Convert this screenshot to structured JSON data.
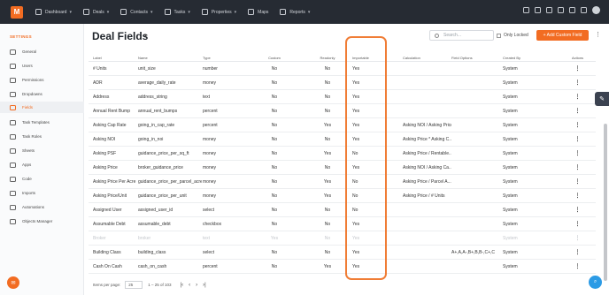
{
  "nav": {
    "logo_text": "M",
    "items": [
      {
        "label": "Dashboard",
        "icon": "home-icon"
      },
      {
        "label": "Deals",
        "icon": "deals-icon"
      },
      {
        "label": "Contacts",
        "icon": "contacts-icon"
      },
      {
        "label": "Tasks",
        "icon": "tasks-icon"
      },
      {
        "label": "Properties",
        "icon": "properties-icon"
      },
      {
        "label": "Maps",
        "icon": "maps-icon"
      },
      {
        "label": "Reports",
        "icon": "reports-icon"
      }
    ]
  },
  "sidebar": {
    "title": "SETTINGS",
    "items": [
      {
        "label": "General"
      },
      {
        "label": "Users"
      },
      {
        "label": "Permissions"
      },
      {
        "label": "Dropdowns"
      },
      {
        "label": "Fields"
      },
      {
        "label": "Task Templates"
      },
      {
        "label": "Task Roles"
      },
      {
        "label": "Sheets"
      },
      {
        "label": "Apps"
      },
      {
        "label": "Code"
      },
      {
        "label": "Imports"
      },
      {
        "label": "Automations"
      },
      {
        "label": "Objects Manager"
      }
    ]
  },
  "header": {
    "title": "Deal Fields",
    "search_placeholder": "Search...",
    "only_locked_label": "Only Locked",
    "add_button_label": "+ Add Custom Field"
  },
  "table": {
    "columns": [
      "Label",
      "Name",
      "Type",
      "Custom",
      "Readonly",
      "Importable",
      "Calculation",
      "Field Options",
      "Created By",
      "Actions"
    ],
    "rows": [
      {
        "label": "# Units",
        "name": "unit_size",
        "type": "number",
        "custom": "No",
        "readonly": "No",
        "importable": "Yes",
        "calc": "",
        "options": "",
        "created": "System"
      },
      {
        "label": "ADR",
        "name": "average_daily_rate",
        "type": "money",
        "custom": "No",
        "readonly": "No",
        "importable": "Yes",
        "calc": "",
        "options": "",
        "created": "System"
      },
      {
        "label": "Address",
        "name": "address_string",
        "type": "text",
        "custom": "No",
        "readonly": "No",
        "importable": "Yes",
        "calc": "",
        "options": "",
        "created": "System"
      },
      {
        "label": "Annual Rent Bump",
        "name": "annual_rent_bumps",
        "type": "percent",
        "custom": "No",
        "readonly": "No",
        "importable": "Yes",
        "calc": "",
        "options": "",
        "created": "System"
      },
      {
        "label": "Asking Cap Rate",
        "name": "going_in_cap_rate",
        "type": "percent",
        "custom": "No",
        "readonly": "Yes",
        "importable": "Yes",
        "calc": "Asking NOI / Asking Price",
        "options": "",
        "created": "System"
      },
      {
        "label": "Asking NOI",
        "name": "going_in_noi",
        "type": "money",
        "custom": "No",
        "readonly": "No",
        "importable": "Yes",
        "calc": "Asking Price * Asking C...",
        "options": "",
        "created": "System"
      },
      {
        "label": "Asking PSF",
        "name": "guidance_price_per_sq_ft",
        "type": "money",
        "custom": "No",
        "readonly": "Yes",
        "importable": "No",
        "calc": "Asking Price / Rentable...",
        "options": "",
        "created": "System"
      },
      {
        "label": "Asking Price",
        "name": "broker_guidance_price",
        "type": "money",
        "custom": "No",
        "readonly": "No",
        "importable": "Yes",
        "calc": "Asking NOI / Asking Ca...",
        "options": "",
        "created": "System"
      },
      {
        "label": "Asking Price Per Acre",
        "name": "guidance_price_per_parcel_acre",
        "type": "money",
        "custom": "No",
        "readonly": "Yes",
        "importable": "No",
        "calc": "Asking Price / Parcel A...",
        "options": "",
        "created": "System"
      },
      {
        "label": "Asking Price/Unit",
        "name": "guidance_price_per_unit",
        "type": "money",
        "custom": "No",
        "readonly": "Yes",
        "importable": "No",
        "calc": "Asking Price / # Units",
        "options": "",
        "created": "System"
      },
      {
        "label": "Assigned User",
        "name": "assigned_user_id",
        "type": "select",
        "custom": "No",
        "readonly": "No",
        "importable": "No",
        "calc": "",
        "options": "",
        "created": "System"
      },
      {
        "label": "Assumable Debt",
        "name": "assumable_debt",
        "type": "checkbox",
        "custom": "No",
        "readonly": "No",
        "importable": "Yes",
        "calc": "",
        "options": "",
        "created": "System"
      },
      {
        "label": "Broker",
        "name": "broker",
        "type": "text",
        "custom": "Yes",
        "readonly": "No",
        "importable": "Yes",
        "calc": "",
        "options": "",
        "created": "System"
      },
      {
        "label": "Building Class",
        "name": "building_class",
        "type": "select",
        "custom": "No",
        "readonly": "No",
        "importable": "Yes",
        "calc": "",
        "options": "A+,A,A-,B+,B,B-,C+,C",
        "created": "System"
      },
      {
        "label": "Cash On Cash",
        "name": "cash_on_cash",
        "type": "percent",
        "custom": "No",
        "readonly": "Yes",
        "importable": "Yes",
        "calc": "",
        "options": "",
        "created": "System"
      }
    ]
  },
  "pager": {
    "items_per_page_label": "Items per page:",
    "items_per_page_value": "25",
    "range": "1 – 25 of 103"
  },
  "colors": {
    "accent": "#f26c22",
    "nav_bg": "#262b33",
    "help": "#2c9be5"
  }
}
